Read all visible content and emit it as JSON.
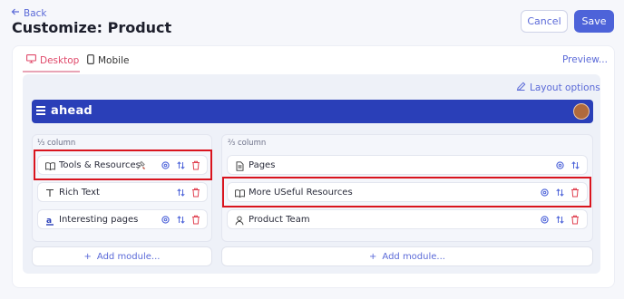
{
  "nav": {
    "back_label": "Back"
  },
  "page": {
    "title": "Customize: Product"
  },
  "actions": {
    "cancel_label": "Cancel",
    "save_label": "Save"
  },
  "tabs": [
    {
      "label": "Desktop",
      "active": true
    },
    {
      "label": "Mobile",
      "active": false
    }
  ],
  "preview_label": "Preview...",
  "layout_options_label": "Layout options",
  "header": {
    "logo": "ahead"
  },
  "columns": {
    "left": {
      "label": "⅓ column",
      "modules": [
        {
          "label": "Tools & Resources",
          "icon": "book-icon",
          "extra_icon": "tools-emoji-icon"
        },
        {
          "label": "Rich Text",
          "icon": "text-icon"
        },
        {
          "label": "Interesting pages",
          "icon": "ahead-logo-icon"
        }
      ],
      "add_label": "Add module..."
    },
    "right": {
      "label": "⅔ column",
      "modules": [
        {
          "label": "Pages",
          "icon": "page-icon"
        },
        {
          "label": "More USeful Resources",
          "icon": "book-icon"
        },
        {
          "label": "Product Team",
          "icon": "user-icon"
        }
      ],
      "add_label": "Add module..."
    }
  },
  "colors": {
    "accent": "#4d63d9",
    "brand_header": "#2a3fb8",
    "active_tab": "#e0496a",
    "delete": "#e04050",
    "highlight": "#d9141e"
  }
}
